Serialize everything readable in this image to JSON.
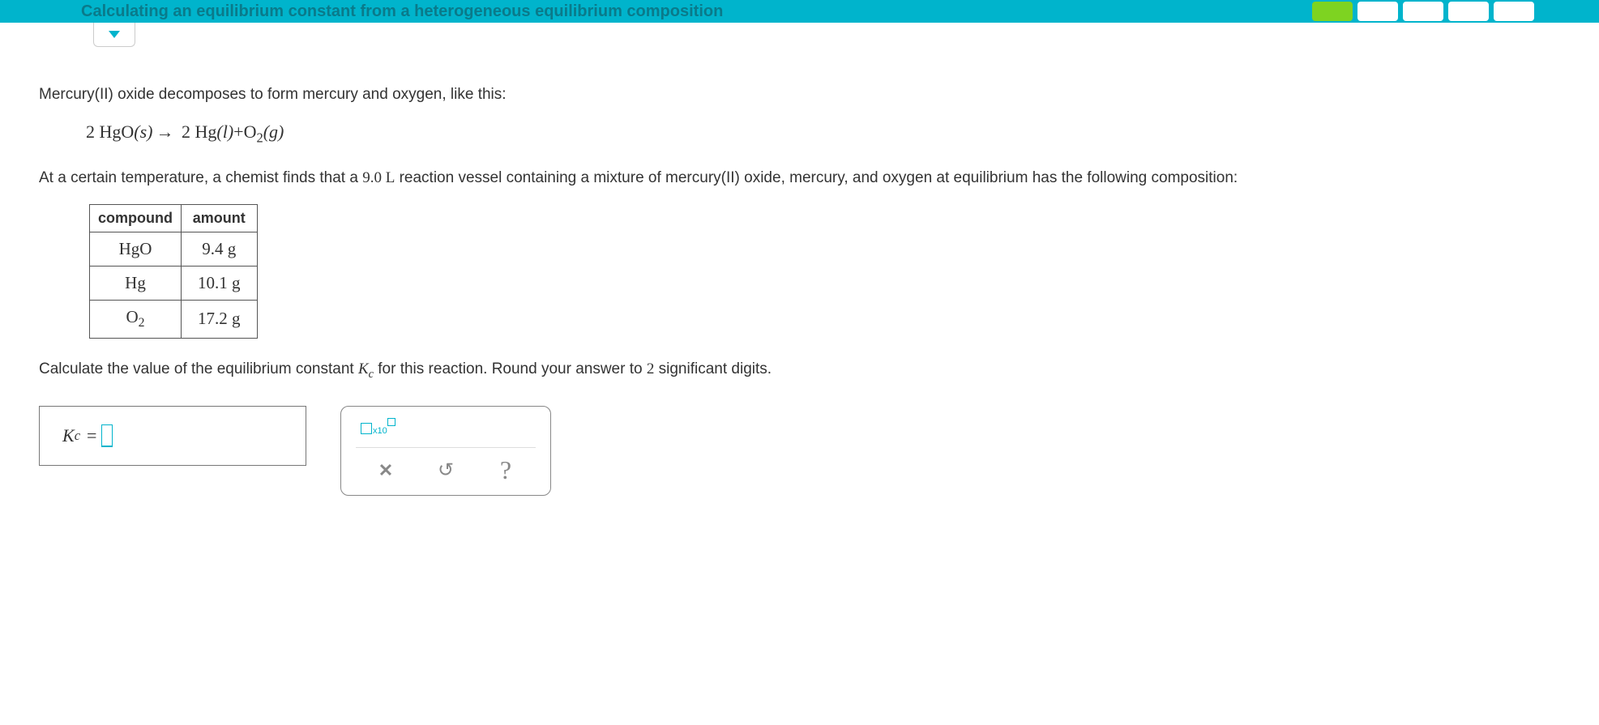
{
  "header": {
    "title": "Calculating an equilibrium constant from a heterogeneous equilibrium composition"
  },
  "problem": {
    "intro": "Mercury(II) oxide decomposes to form mercury and oxygen, like this:",
    "equation": {
      "left_coef": "2",
      "left_species": "HgO",
      "left_state": "(s)",
      "right1_coef": "2",
      "right1_species": "Hg",
      "right1_state": "(l)",
      "right2_species": "O",
      "right2_sub": "2",
      "right2_state": "(g)"
    },
    "context_pre": "At a certain temperature, a chemist finds that a ",
    "volume": "9.0 L",
    "context_post": " reaction vessel containing a mixture of mercury(II) oxide, mercury, and oxygen at equilibrium has the following composition:",
    "table": {
      "h1": "compound",
      "h2": "amount",
      "rows": [
        {
          "compound_html": "HgO",
          "amount": "9.4 g"
        },
        {
          "compound_html": "Hg",
          "amount": "10.1 g"
        },
        {
          "compound_html": "O<sub>2</sub>",
          "amount": "17.2 g"
        }
      ]
    },
    "prompt_pre": "Calculate the value of the equilibrium constant ",
    "prompt_var": "K",
    "prompt_sub": "c",
    "prompt_post": " for this reaction. Round your answer to ",
    "sig": "2",
    "prompt_end": " significant digits.",
    "answer_label_var": "K",
    "answer_label_sub": "c",
    "answer_eq": "="
  },
  "toolbox": {
    "sci_x10": "x10"
  }
}
